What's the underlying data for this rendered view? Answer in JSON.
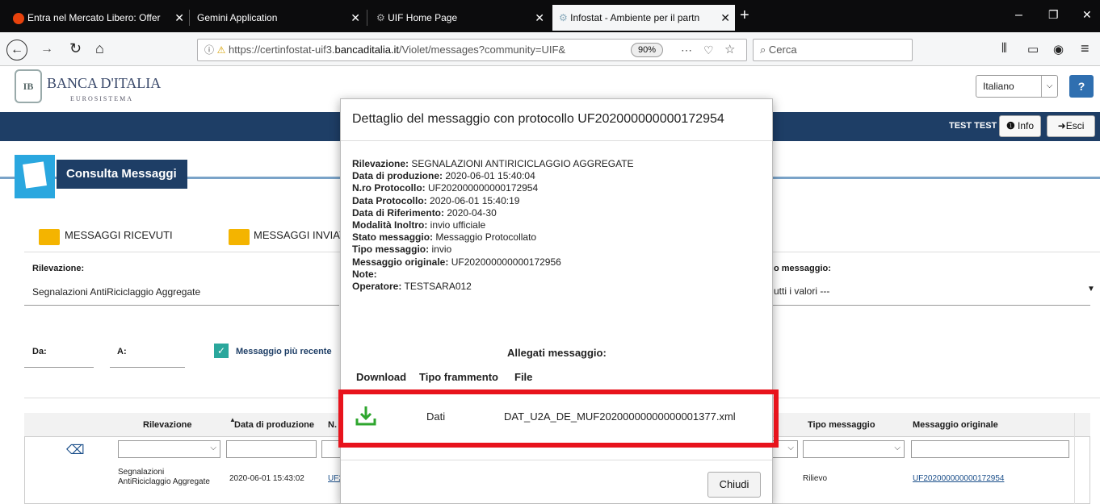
{
  "browser": {
    "tabs": [
      {
        "label": "Entra nel Mercato Libero: Offer",
        "active": false
      },
      {
        "label": "Gemini Application",
        "active": false
      },
      {
        "label": "UIF Home Page",
        "active": false
      },
      {
        "label": "Infostat - Ambiente per il partn",
        "active": true
      }
    ],
    "url_prefix": "https://certinfostat-uif3.",
    "url_domain": "bancaditalia.it",
    "url_suffix": "/Violet/messages?community=UIF&",
    "zoom": "90%",
    "search_placeholder": "Cerca"
  },
  "header": {
    "logo_line1": "BANCA D'ITALIA",
    "logo_line2": "EUROSISTEMA",
    "language": "Italiano",
    "user": "TEST TEST",
    "info_label": "Info",
    "exit_label": "Esci"
  },
  "page": {
    "title": "Consulta Messaggi",
    "tab_received": "MESSAGGI RICEVUTI",
    "tab_sent": "MESSAGGI INVIAT",
    "rilevazione_label": "Rilevazione:",
    "rilevazione_value": "Segnalazioni AntiRiciclaggio Aggregate",
    "tipo_label": "o messaggio:",
    "tipo_value": "utti i valori ---",
    "da_label": "Da:",
    "a_label": "A:",
    "recent_label": "Messaggio più recente"
  },
  "table": {
    "headers": [
      "Rilevazione",
      "Data di produzione",
      "N.",
      "Tipo messaggio",
      "Messaggio originale"
    ],
    "row": {
      "rilevazione_1": "Segnalazioni",
      "rilevazione_2": "AntiRiciclaggio Aggregate",
      "data": "2020-06-01 15:43:02",
      "num": "UF2",
      "tipo": "Rilievo",
      "originale": "UF202000000000172954"
    }
  },
  "modal": {
    "title": "Dettaglio del messaggio con protocollo UF202000000000172954",
    "fields": [
      {
        "label": "Rilevazione:",
        "value": "SEGNALAZIONI ANTIRICICLAGGIO AGGREGATE"
      },
      {
        "label": "Data di produzione:",
        "value": "2020-06-01 15:40:04"
      },
      {
        "label": "N.ro Protocollo:",
        "value": "UF202000000000172954"
      },
      {
        "label": "Data Protocollo:",
        "value": "2020-06-01 15:40:19"
      },
      {
        "label": "Data di Riferimento:",
        "value": "2020-04-30"
      },
      {
        "label": "Modalità Inoltro:",
        "value": "invio ufficiale"
      },
      {
        "label": "Stato messaggio:",
        "value": "Messaggio Protocollato"
      },
      {
        "label": "Tipo messaggio:",
        "value": "invio"
      },
      {
        "label": "Messaggio originale:",
        "value": "UF202000000000172956"
      },
      {
        "label": "Note:",
        "value": ""
      },
      {
        "label": "Operatore:",
        "value": "TESTSARA012"
      }
    ],
    "attachments_title": "Allegati messaggio:",
    "col_download": "Download",
    "col_tipo": "Tipo frammento",
    "col_file": "File",
    "attachment_tipo": "Dati",
    "attachment_file": "DAT_U2A_DE_MUF20200000000000001377.xml",
    "close_label": "Chiudi"
  },
  "colors": {
    "highlight": "#e8131c",
    "band": "#1e3e66",
    "download": "#2ea62e"
  }
}
